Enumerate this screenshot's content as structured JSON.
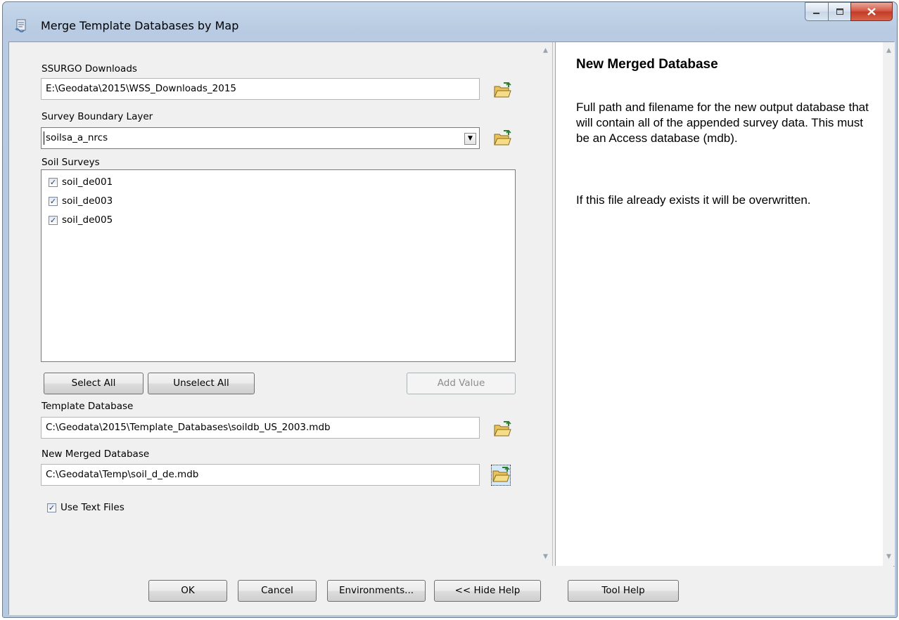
{
  "window": {
    "title": "Merge Template Databases by Map"
  },
  "form": {
    "ssurgo_label": "SSURGO Downloads",
    "ssurgo_value": "E:\\Geodata\\2015\\WSS_Downloads_2015",
    "boundary_label": "Survey Boundary Layer",
    "boundary_value": "soilsa_a_nrcs",
    "surveys_label": "Soil Surveys",
    "surveys": [
      {
        "label": "soil_de001",
        "checked": true
      },
      {
        "label": "soil_de003",
        "checked": true
      },
      {
        "label": "soil_de005",
        "checked": true
      }
    ],
    "select_all": "Select All",
    "unselect_all": "Unselect All",
    "add_value": "Add Value",
    "template_label": "Template Database",
    "template_value": "C:\\Geodata\\2015\\Template_Databases\\soildb_US_2003.mdb",
    "merged_label": "New Merged Database",
    "merged_value": "C:\\Geodata\\Temp\\soil_d_de.mdb",
    "use_text_files": "Use Text Files",
    "use_text_files_checked": true
  },
  "help": {
    "title": "New Merged Database",
    "paragraph1": "Full path and filename for the new output database that will contain all of the appended survey data. This must be an Access database (mdb).",
    "paragraph2": "If this file already exists it will be overwritten."
  },
  "buttons": {
    "ok": "OK",
    "cancel": "Cancel",
    "environments": "Environments...",
    "hide_help": "<< Hide Help",
    "tool_help": "Tool Help"
  },
  "icons": {
    "app": "toolbox-script-icon",
    "browse": "open-folder-icon",
    "check": "✓"
  }
}
